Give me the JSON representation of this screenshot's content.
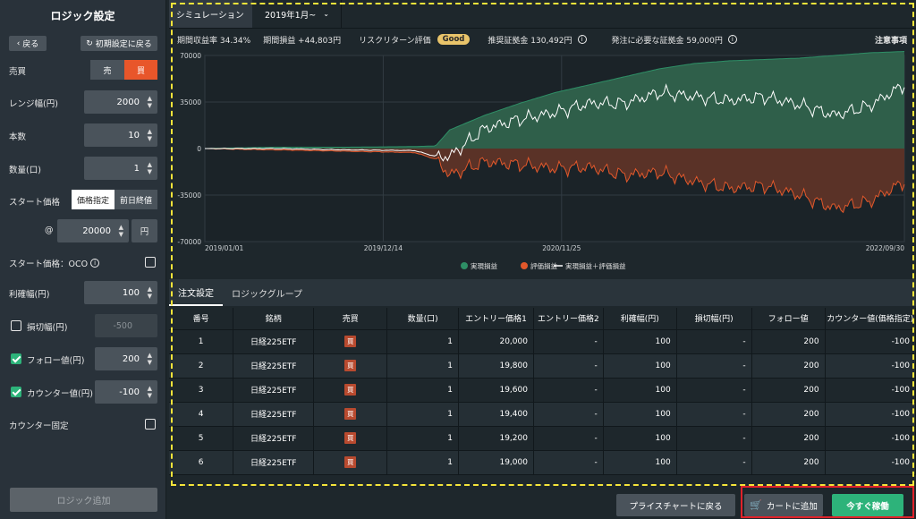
{
  "left": {
    "title": "ロジック設定",
    "back_label": "戻る",
    "reset_label": "初期設定に戻る",
    "side_label": "売買",
    "sell": "売",
    "buy": "買",
    "range_label": "レンジ幅(円)",
    "range_value": "2000",
    "count_label": "本数",
    "count_value": "10",
    "qty_label": "数量(口)",
    "qty_value": "1",
    "start_label": "スタート価格",
    "price_spec": "価格指定",
    "prev_close": "前日終値",
    "at": "@",
    "start_value": "20000",
    "yen": "円",
    "oco_label": "スタート価格：OCO",
    "profit_label": "利確幅(円)",
    "profit_value": "100",
    "loss_label": "損切幅(円)",
    "loss_value": "-500",
    "follow_label": "フォロー値(円)",
    "follow_value": "200",
    "counter_label": "カウンター値(円)",
    "counter_value": "-100",
    "counter_fixed_label": "カウンター固定",
    "add_logic": "ロジック追加"
  },
  "main": {
    "tab_sim": "シミュレーション",
    "tab_period": "2019年1月~",
    "stat_rate": "期間収益率 34.34%",
    "stat_profit": "期間損益 +44,803円",
    "stat_rr": "リスクリターン評価",
    "stat_good": "Good",
    "stat_margin": "推奨証拠金 130,492円",
    "stat_need": "発注に必要な証拠金 59,000円",
    "stat_note": "注意事項",
    "subtab_order": "注文設定",
    "subtab_group": "ロジックグループ",
    "btn_price_chart": "プライスチャートに戻る",
    "btn_cart": "カートに追加",
    "btn_run": "今すぐ稼働"
  },
  "table": {
    "headers": [
      "番号",
      "銘柄",
      "売買",
      "数量(口)",
      "エントリー価格1",
      "エントリー価格2",
      "利確幅(円)",
      "損切幅(円)",
      "フォロー値",
      "カウンター値(価格指定)"
    ],
    "rows": [
      [
        "1",
        "日経225ETF",
        "買",
        "1",
        "20,000",
        "-",
        "100",
        "-",
        "200",
        "-100"
      ],
      [
        "2",
        "日経225ETF",
        "買",
        "1",
        "19,800",
        "-",
        "100",
        "-",
        "200",
        "-100"
      ],
      [
        "3",
        "日経225ETF",
        "買",
        "1",
        "19,600",
        "-",
        "100",
        "-",
        "200",
        "-100"
      ],
      [
        "4",
        "日経225ETF",
        "買",
        "1",
        "19,400",
        "-",
        "100",
        "-",
        "200",
        "-100"
      ],
      [
        "5",
        "日経225ETF",
        "買",
        "1",
        "19,200",
        "-",
        "100",
        "-",
        "200",
        "-100"
      ],
      [
        "6",
        "日経225ETF",
        "買",
        "1",
        "19,000",
        "-",
        "100",
        "-",
        "200",
        "-100"
      ]
    ]
  },
  "chart_data": {
    "type": "area",
    "x_ticks": [
      "2019/01/01",
      "2019/12/14",
      "2020/11/25",
      "2022/09/30"
    ],
    "y_ticks": [
      70000,
      35000,
      0,
      -35000,
      -70000
    ],
    "ylim": [
      -70000,
      70000
    ],
    "legend": [
      "実現損益",
      "評価損益",
      "実現損益＋評価損益"
    ],
    "legend_position": "bottom-center",
    "colors": {
      "realized": "#2e8f66",
      "realized_fill": "#2f5f4a",
      "unrealized": "#e2582b",
      "unrealized_fill": "#5a3227",
      "total": "#ffffff"
    },
    "x_fraction": [
      0,
      0.1,
      0.2,
      0.3,
      0.33,
      0.35,
      0.4,
      0.45,
      0.5,
      0.55,
      0.6,
      0.65,
      0.7,
      0.75,
      0.8,
      0.85,
      0.9,
      0.95,
      1
    ],
    "realized": [
      0,
      1000,
      1000,
      1500,
      2000,
      14000,
      25000,
      34000,
      42000,
      48000,
      54000,
      60000,
      64000,
      66000,
      67000,
      68000,
      70000,
      72000,
      73000
    ],
    "unrealized": [
      0,
      -1000,
      -2000,
      -3000,
      -8000,
      -20000,
      -10000,
      -12000,
      -15000,
      -14000,
      -20000,
      -18000,
      -25000,
      -30000,
      -28000,
      -35000,
      -45000,
      -40000,
      -25000
    ],
    "total": [
      0,
      0,
      -1000,
      -1500,
      -6000,
      -6000,
      15000,
      22000,
      27000,
      34000,
      34000,
      42000,
      39000,
      36000,
      39000,
      33000,
      25000,
      32000,
      48000
    ]
  }
}
